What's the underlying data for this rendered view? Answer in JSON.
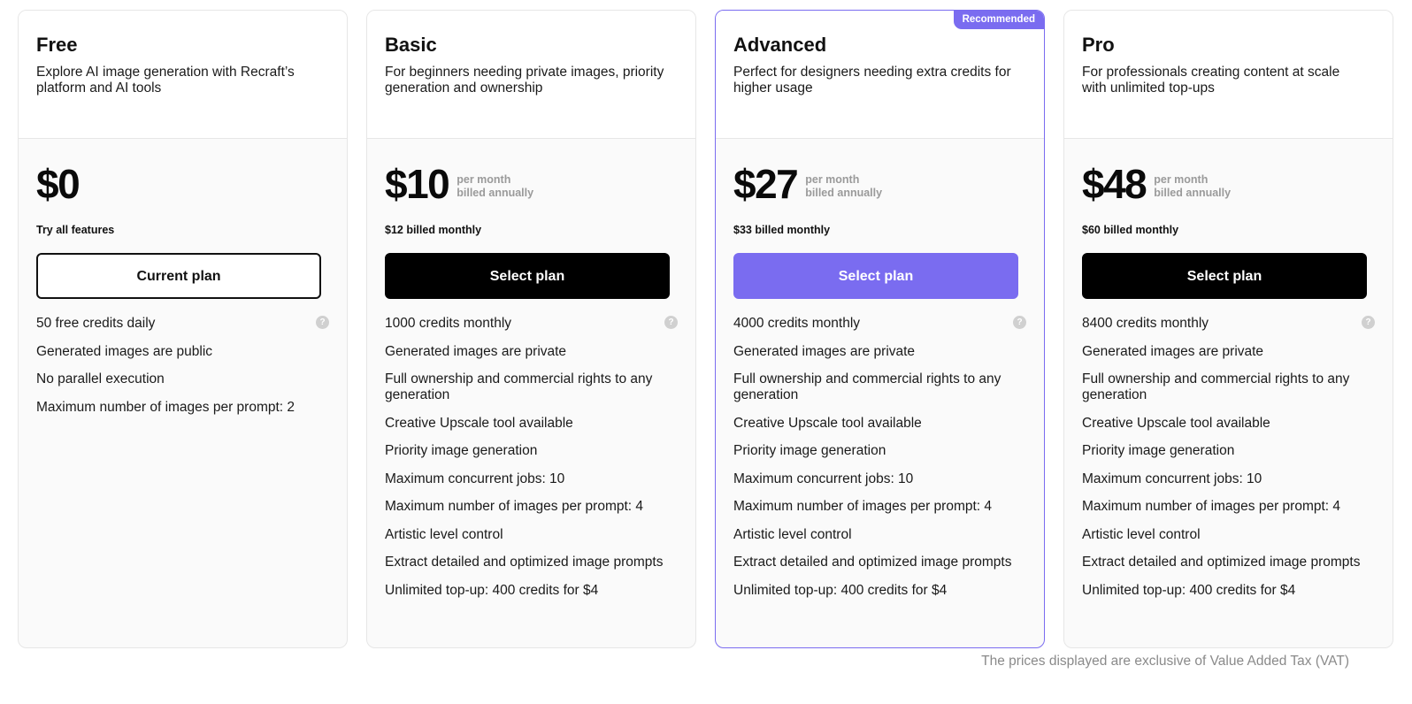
{
  "plans": [
    {
      "name": "Free",
      "description": "Explore AI image generation with Recraft’s platform and AI tools",
      "badge": "",
      "price": "$0",
      "per": "",
      "billed": "",
      "subline": "Try all features",
      "cta": "Current plan",
      "features": [
        "50 free credits daily",
        "Generated images are public",
        "No parallel execution",
        "Maximum number of images per prompt: 2"
      ]
    },
    {
      "name": "Basic",
      "description": "For beginners needing private images, priority generation and ownership",
      "badge": "",
      "price": "$10",
      "per": "per month",
      "billed": "billed annually",
      "subline": "$12 billed monthly",
      "cta": "Select plan",
      "features": [
        "1000 credits monthly",
        "Generated images are private",
        "Full ownership and commercial rights to any generation",
        "Creative Upscale tool available",
        "Priority image generation",
        "Maximum concurrent jobs: 10",
        "Maximum number of images per prompt: 4",
        "Artistic level control",
        "Extract detailed and optimized image prompts",
        "Unlimited top-up: 400 credits for $4"
      ]
    },
    {
      "name": "Advanced",
      "description": "Perfect for designers needing extra credits for higher usage",
      "badge": "Recommended",
      "price": "$27",
      "per": "per month",
      "billed": "billed annually",
      "subline": "$33 billed monthly",
      "cta": "Select plan",
      "features": [
        "4000 credits monthly",
        "Generated images are private",
        "Full ownership and commercial rights to any generation",
        "Creative Upscale tool available",
        "Priority image generation",
        "Maximum concurrent jobs: 10",
        "Maximum number of images per prompt: 4",
        "Artistic level control",
        "Extract detailed and optimized image prompts",
        "Unlimited top-up: 400 credits for $4"
      ]
    },
    {
      "name": "Pro",
      "description": "For professionals creating content at scale with unlimited top-ups",
      "badge": "",
      "price": "$48",
      "per": "per month",
      "billed": "billed annually",
      "subline": "$60 billed monthly",
      "cta": "Select plan",
      "features": [
        "8400 credits monthly",
        "Generated images are private",
        "Full ownership and commercial rights to any generation",
        "Creative Upscale tool available",
        "Priority image generation",
        "Maximum concurrent jobs: 10",
        "Maximum number of images per prompt: 4",
        "Artistic level control",
        "Extract detailed and optimized image prompts",
        "Unlimited top-up: 400 credits for $4"
      ]
    }
  ],
  "help_icon": {
    "name": "help-circle-icon",
    "glyph": "?"
  },
  "colors": {
    "accent": "#7a6cf0",
    "dark": "#000000",
    "muted": "#8a8a8a"
  },
  "footer": {
    "vat_note": "The prices displayed are exclusive of Value Added Tax (VAT)"
  }
}
